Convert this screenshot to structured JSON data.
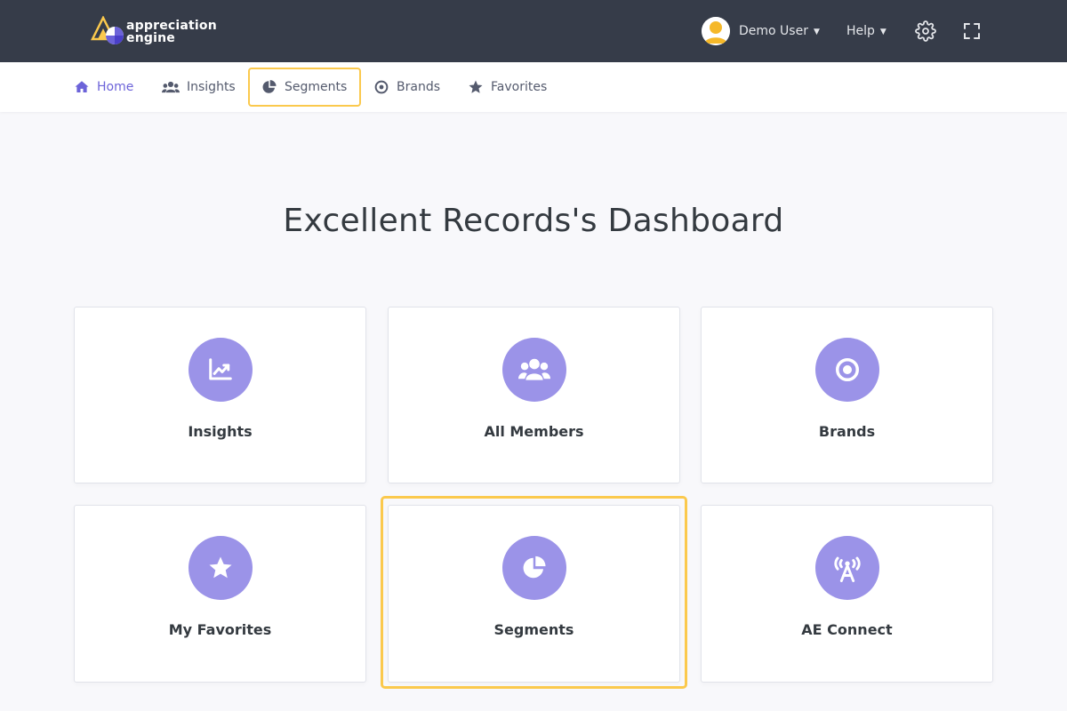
{
  "header": {
    "logo_line1": "appreciation",
    "logo_line2": "engine",
    "user_name": "Demo User",
    "help_label": "Help",
    "bg_color": "#363c49"
  },
  "nav": {
    "items": [
      {
        "label": "Home",
        "icon": "home-icon",
        "active": true
      },
      {
        "label": "Insights",
        "icon": "users-icon",
        "active": false
      },
      {
        "label": "Segments",
        "icon": "pie-chart-icon",
        "active": false,
        "highlighted": true
      },
      {
        "label": "Brands",
        "icon": "target-icon",
        "active": false
      },
      {
        "label": "Favorites",
        "icon": "star-icon",
        "active": false
      }
    ],
    "active_color": "#6c63d9",
    "highlight_color": "#fbc94d"
  },
  "dashboard": {
    "title": "Excellent Records's Dashboard",
    "cards": [
      {
        "label": "Insights",
        "icon": "chart-line-icon"
      },
      {
        "label": "All Members",
        "icon": "users-icon"
      },
      {
        "label": "Brands",
        "icon": "target-icon"
      },
      {
        "label": "My Favorites",
        "icon": "star-icon"
      },
      {
        "label": "Segments",
        "icon": "pie-chart-icon",
        "highlighted": true
      },
      {
        "label": "AE Connect",
        "icon": "broadcast-tower-icon"
      }
    ],
    "icon_circle_color": "#9b93e8"
  }
}
